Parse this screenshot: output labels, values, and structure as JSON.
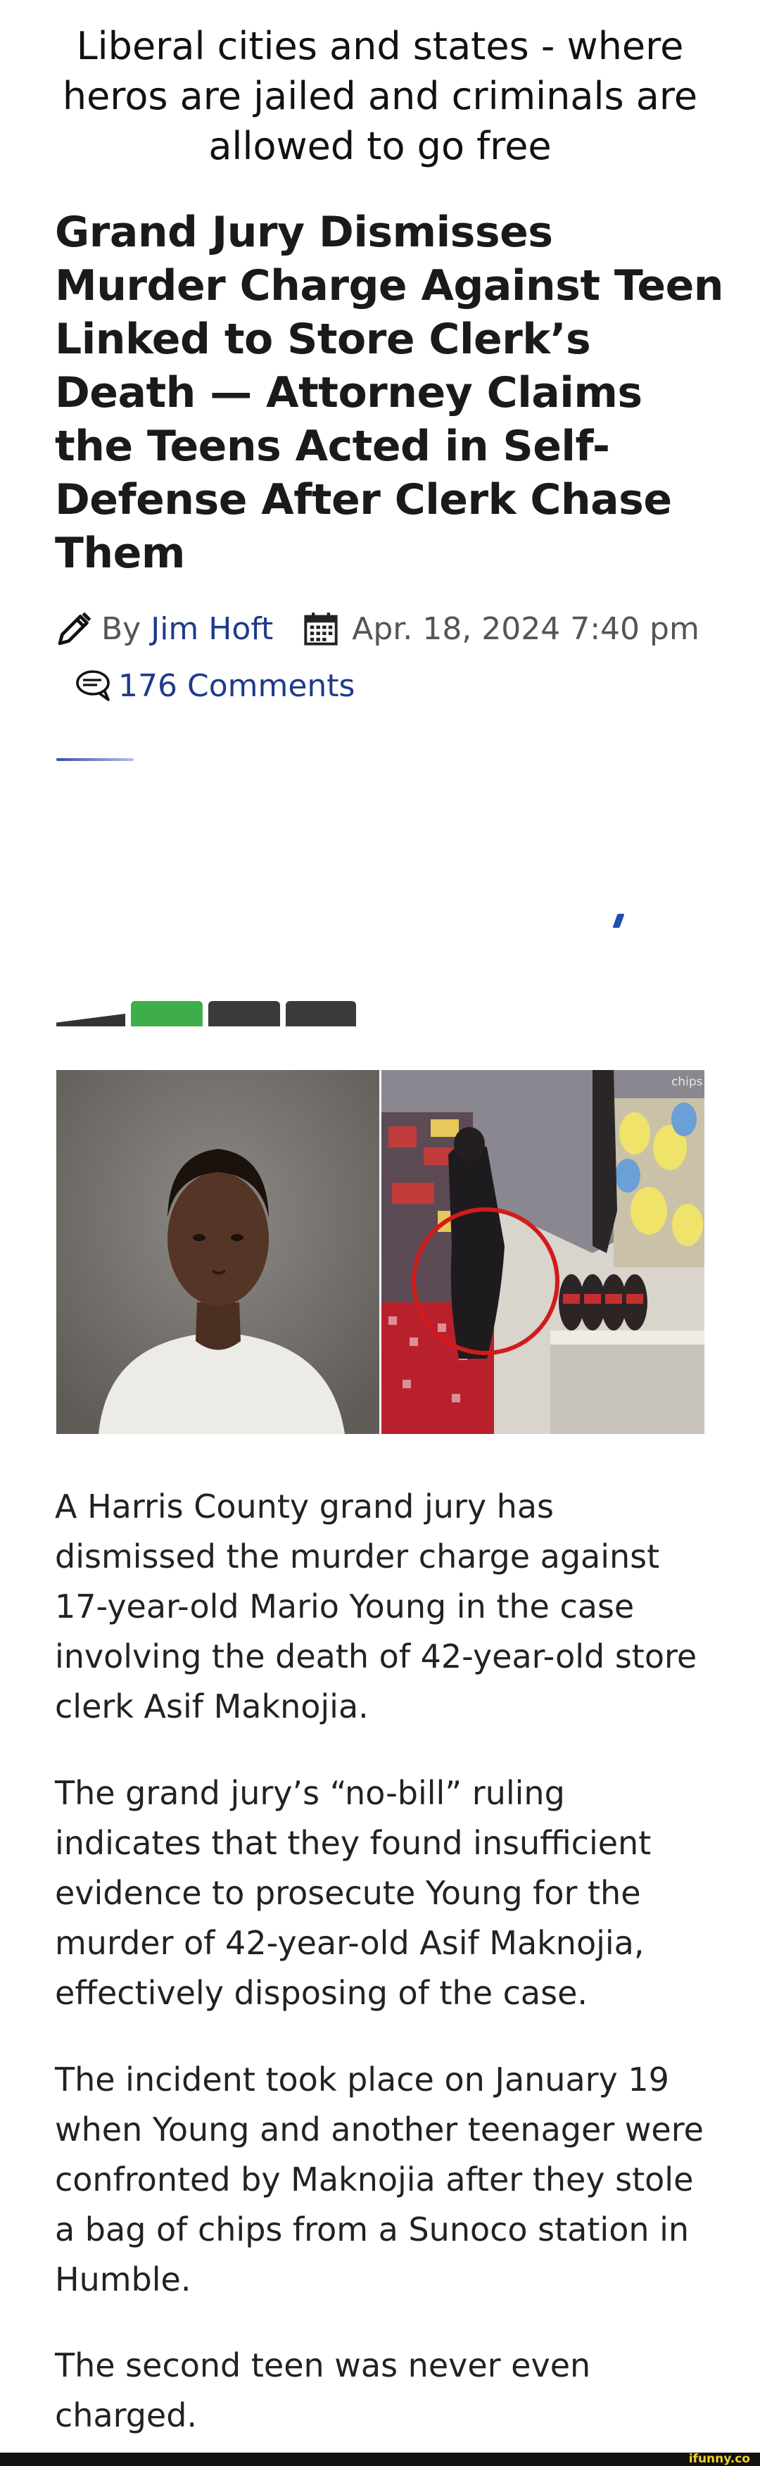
{
  "meme_caption": "Liberal cities and states - where heros are jailed and criminals are allowed to go free",
  "article": {
    "headline": "Grand Jury Dismisses Murder Charge Against Teen Linked to Store Clerk’s Death — Attorney Claims the Teens Acted in Self-Defense After Clerk Chase Them",
    "by_prefix": "By",
    "author": "Jim Hoft",
    "date": "Apr. 18, 2024 7:40 pm",
    "comments": "176 Comments",
    "photo_label": "chips",
    "paragraphs": [
      "A Harris County grand jury has dismissed the murder charge against 17-year-old Mario Young in the case involving the death of 42-year-old store clerk Asif Maknojia.",
      "The grand jury’s “no-bill” ruling indicates that they found insufficient evidence to prosecute Young for the murder of 42-year-old Asif Maknojia, effectively disposing of the case.",
      "The incident took place on January 19 when Young and another teenager were confronted by Maknojia after they stole a bag of chips from a Sunoco station in Humble.",
      "The second teen was never even charged."
    ]
  },
  "watermark": "ifunny.co",
  "colors": {
    "link": "#1f3a8a",
    "tab_green": "#3dae49",
    "footer": "#111111",
    "watermark": "#f3d22b"
  }
}
